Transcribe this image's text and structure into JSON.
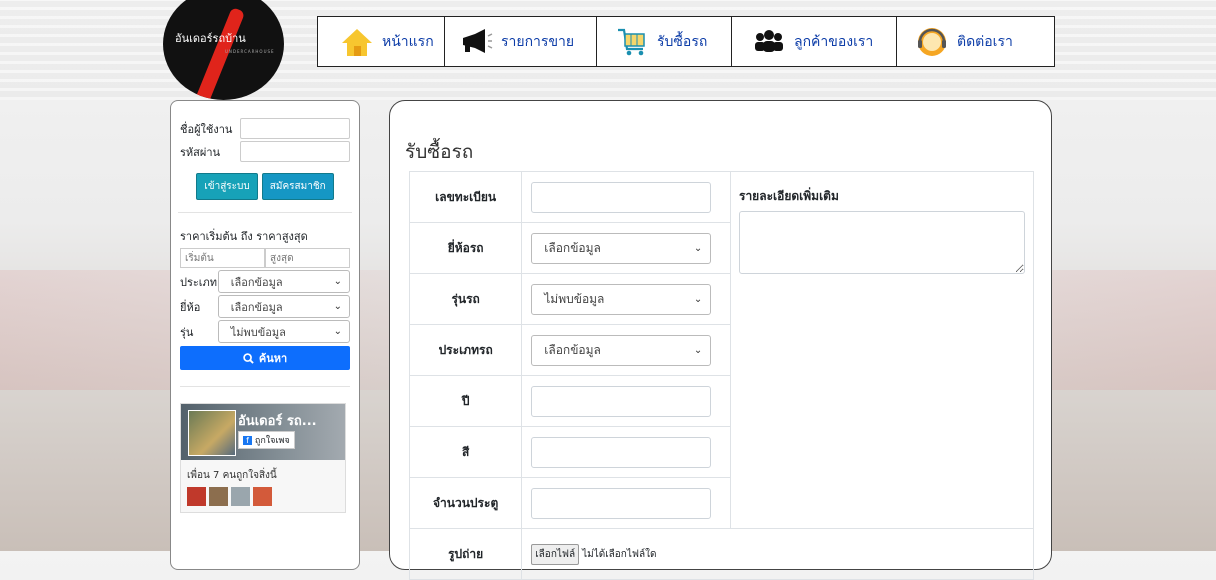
{
  "logo": {
    "text": "อันเดอร์รถบ้าน",
    "subtext": "UNDERCARHOUSE"
  },
  "nav": [
    {
      "label": "หน้าแรก",
      "icon": "home-icon"
    },
    {
      "label": "รายการขาย",
      "icon": "megaphone-icon"
    },
    {
      "label": "รับซื้อรถ",
      "icon": "cart-icon"
    },
    {
      "label": "ลูกค้าของเรา",
      "icon": "people-icon"
    },
    {
      "label": "ติดต่อเรา",
      "icon": "support-icon"
    }
  ],
  "sidebar": {
    "username_label": "ชื่อผู้ใช้งาน",
    "password_label": "รหัสผ่าน",
    "login_button": "เข้าสู่ระบบ",
    "register_button": "สมัครสมาชิก",
    "price_label": "ราคาเริ่มต้น ถึง ราคาสูงสุด",
    "min_placeholder": "เริ่มต้น",
    "max_placeholder": "สูงสุด",
    "type_label": "ประเภท",
    "type_value": "เลือกข้อมูล",
    "brand_label": "ยี่ห้อ",
    "brand_value": "เลือกข้อมูล",
    "model_label": "รุ่น",
    "model_value": "ไม่พบข้อมูล",
    "search_button": "ค้นหา"
  },
  "facebook": {
    "page_name": "อันเดอร์ รถ...",
    "like_button": "ถูกใจเพจ",
    "friends_text": "เพื่อน 7 คนถูกใจสิ่งนี้"
  },
  "main": {
    "title": "รับซื้อรถ",
    "plate_label": "เลขทะเบียน",
    "brand_label": "ยี่ห้อรถ",
    "brand_value": "เลือกข้อมูล",
    "model_label": "รุ่นรถ",
    "model_value": "ไม่พบข้อมูล",
    "type_label": "ประเภทรถ",
    "type_value": "เลือกข้อมูล",
    "year_label": "ปี",
    "color_label": "สี",
    "doors_label": "จำนวนประตู",
    "photo_label": "รูปถ่าย",
    "file_button": "เลือกไฟล์",
    "file_status": "ไม่ได้เลือกไฟล์ใด",
    "extra_label": "รายละเอียดเพิ่มเติม"
  },
  "colors": {
    "nav_text": "#0d3da8",
    "primary": "#0d6efd",
    "info": "#17a2b8",
    "logo_red": "#e0241b"
  }
}
